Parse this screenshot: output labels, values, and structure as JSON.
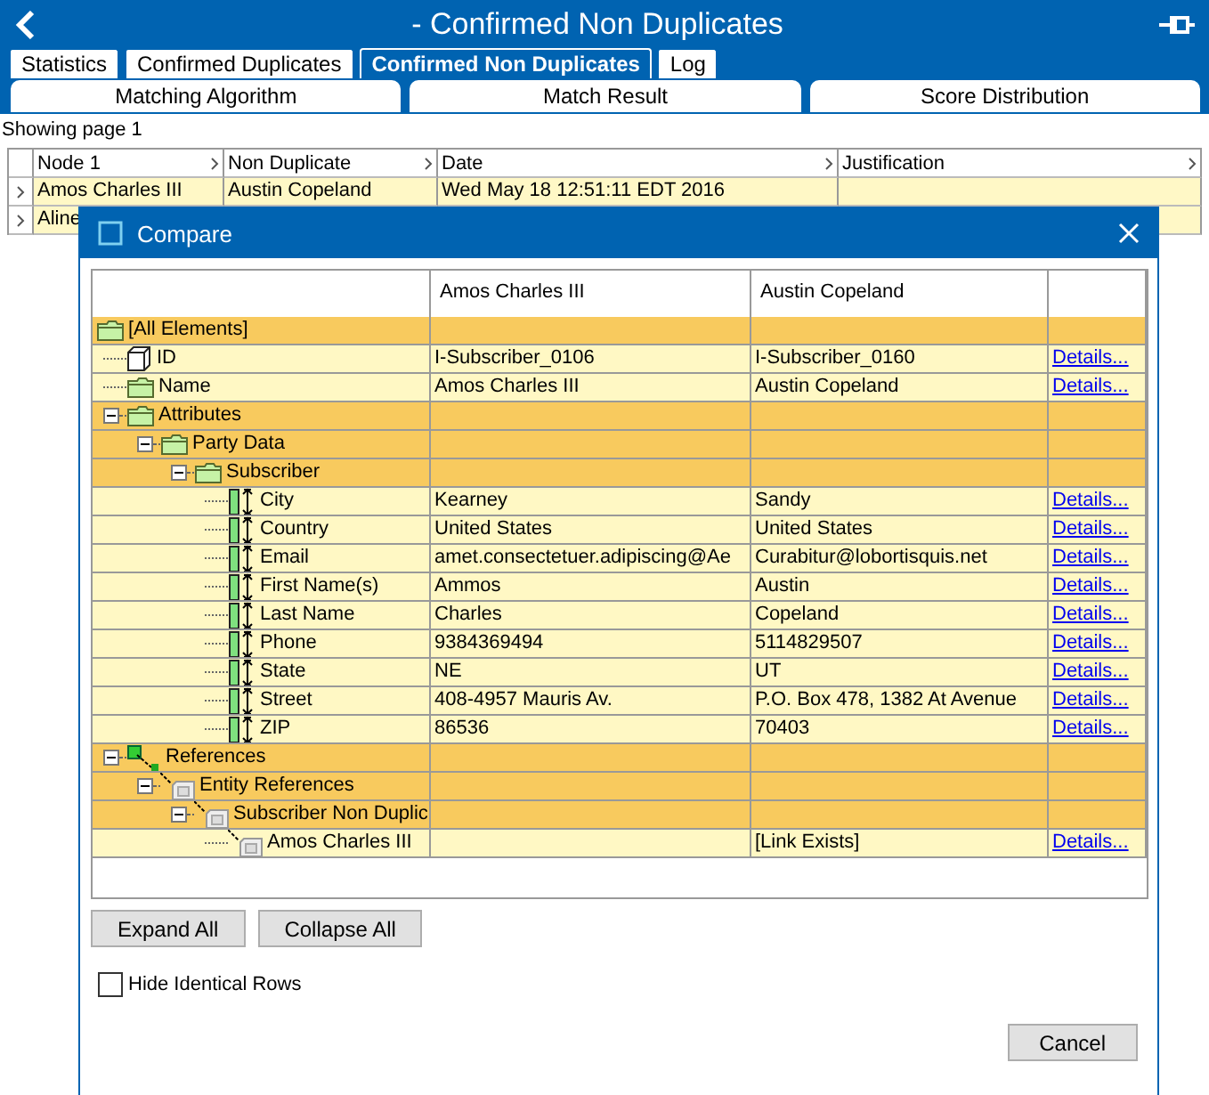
{
  "app": {
    "title": "- Confirmed Non Duplicates"
  },
  "tabs": [
    {
      "label": "Statistics",
      "selected": false
    },
    {
      "label": "Confirmed Duplicates",
      "selected": false
    },
    {
      "label": "Confirmed Non Duplicates",
      "selected": true
    },
    {
      "label": "Log",
      "selected": false
    }
  ],
  "subtabs": [
    "Matching Algorithm",
    "Match Result",
    "Score Distribution"
  ],
  "page_info": "Showing page 1",
  "table": {
    "columns": [
      "Node 1",
      "Non Duplicate",
      "Date",
      "Justification"
    ],
    "rows": [
      {
        "node_1": "Amos Charles III",
        "non_duplicate": "Austin Copeland",
        "date": "Wed May 18 12:51:11 EDT 2016"
      },
      {
        "node_1": "Aline"
      }
    ]
  },
  "dialog": {
    "title": "Compare",
    "columns": [
      "Amos Charles III",
      "Austin Copeland"
    ],
    "tree": [
      {
        "label": "[All Elements]",
        "kind": "folder",
        "children": [
          {
            "label": "ID",
            "kind": "entity",
            "a": "I-Subscriber_0106",
            "b": "I-Subscriber_0160",
            "link": "Details..."
          },
          {
            "label": "Name",
            "kind": "folder",
            "a": "Amos Charles III",
            "b": "Austin Copeland",
            "link": "Details..."
          },
          {
            "label": "Attributes",
            "kind": "folder",
            "expanded": true,
            "children": [
              {
                "label": "Party Data",
                "kind": "folder",
                "expanded": true,
                "children": [
                  {
                    "label": "Subscriber",
                    "kind": "folder",
                    "expanded": true,
                    "children": [
                      {
                        "label": "City",
                        "kind": "attribute",
                        "a": "Kearney",
                        "b": "Sandy",
                        "link": "Details..."
                      },
                      {
                        "label": "Country",
                        "kind": "attribute",
                        "a": "United States",
                        "b": "United States",
                        "link": "Details..."
                      },
                      {
                        "label": "Email",
                        "kind": "attribute",
                        "a": "amet.consectetuer.adipiscing@Ae",
                        "b": "Curabitur@lobortisquis.net",
                        "link": "Details..."
                      },
                      {
                        "label": "First Name(s)",
                        "kind": "attribute",
                        "a": "Ammos",
                        "b": "Austin",
                        "link": "Details..."
                      },
                      {
                        "label": "Last Name",
                        "kind": "attribute",
                        "a": "Charles",
                        "b": "Copeland",
                        "link": "Details..."
                      },
                      {
                        "label": "Phone",
                        "kind": "attribute",
                        "a": "9384369494",
                        "b": "5114829507",
                        "link": "Details..."
                      },
                      {
                        "label": "State",
                        "kind": "attribute",
                        "a": "NE",
                        "b": "UT",
                        "link": "Details..."
                      },
                      {
                        "label": "Street",
                        "kind": "attribute",
                        "a": "408-4957 Mauris Av.",
                        "b": "P.O. Box 478, 1382 At Avenue",
                        "link": "Details..."
                      },
                      {
                        "label": "ZIP",
                        "kind": "attribute",
                        "a": "86536",
                        "b": "70403",
                        "link": "Details..."
                      }
                    ]
                  }
                ]
              }
            ]
          },
          {
            "label": "References",
            "kind": "reference_root",
            "expanded": true,
            "children": [
              {
                "label": "Entity References",
                "kind": "reference",
                "expanded": true,
                "children": [
                  {
                    "label": "Subscriber Non Duplic",
                    "kind": "reference",
                    "expanded": true,
                    "children": [
                      {
                        "label": "Amos Charles III",
                        "kind": "reference",
                        "b": "[Link Exists]",
                        "link": "Details..."
                      }
                    ]
                  }
                ]
              }
            ]
          }
        ]
      }
    ],
    "buttons": [
      "Expand All",
      "Collapse All"
    ],
    "hide_identical": {
      "label": "Hide Identical Rows",
      "checked": false
    },
    "cancel": "Cancel"
  }
}
